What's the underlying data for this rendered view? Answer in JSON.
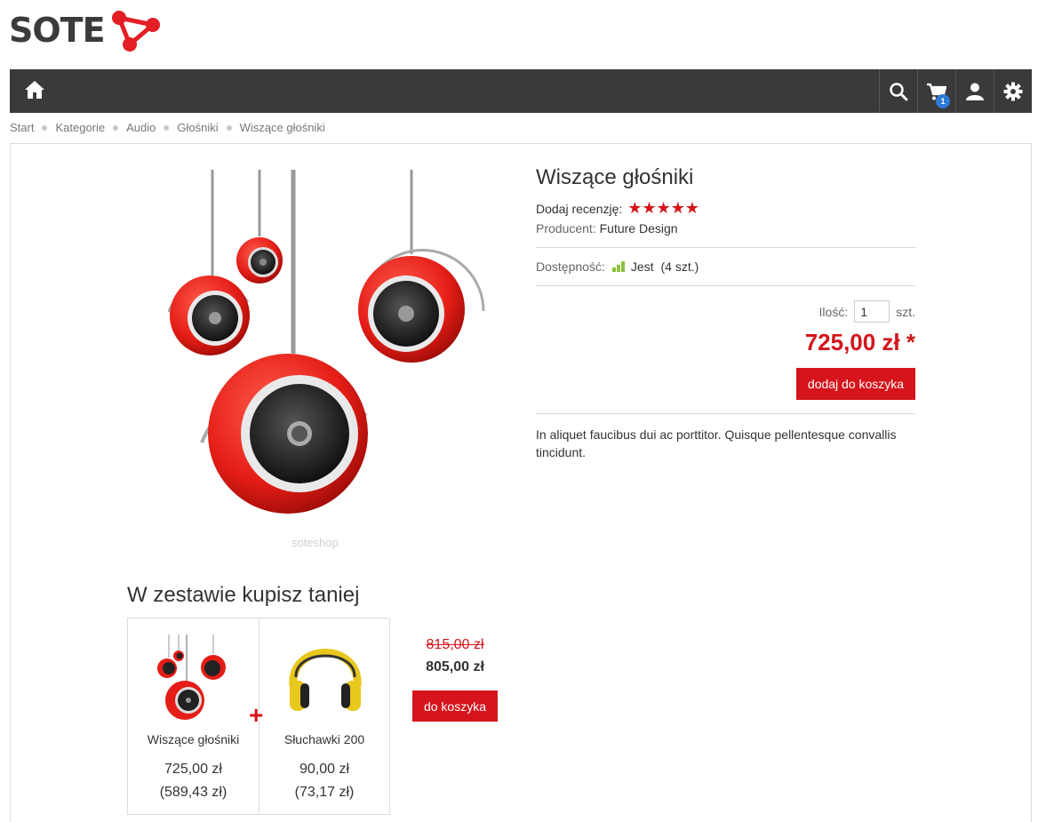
{
  "header": {
    "logo_text": "SOTE",
    "cart_count": "1",
    "nav_icons": [
      "home-icon",
      "search-icon",
      "cart-icon",
      "user-icon",
      "gear-icon"
    ]
  },
  "breadcrumb": [
    "Start",
    "Kategorie",
    "Audio",
    "Głośniki",
    "Wiszące głośniki"
  ],
  "product": {
    "watermark": "soteshop",
    "title": "Wiszące głośniki",
    "review_label": "Dodaj recenzję:",
    "stars": "★★★★★",
    "rating": 5,
    "producer_label": "Producent:",
    "producer_value": "Future Design",
    "availability_label": "Dostępność:",
    "availability_value": "Jest",
    "availability_count": "(4 szt.)",
    "qty_label": "Ilość:",
    "qty_value": "1",
    "qty_unit": "szt.",
    "price": "725,00 zł *",
    "add_to_cart": "dodaj do koszyka",
    "description": "In aliquet faucibus dui ac porttitor. Quisque pellentesque convallis tincidunt."
  },
  "set": {
    "title": "W zestawie kupisz taniej",
    "items": [
      {
        "name": "Wiszące głośniki",
        "price": "725,00 zł",
        "net": "(589,43 zł)"
      },
      {
        "name": "Słuchawki 200",
        "price": "90,00 zł",
        "net": "(73,17 zł)"
      }
    ],
    "plus": "+",
    "old_price": "815,00 zł",
    "new_price": "805,00 zł",
    "button": "do koszyka"
  },
  "colors": {
    "accent": "#d5141b",
    "nav_bg": "#3a3a3a",
    "badge": "#2e7ad9",
    "availability": "#8ac13b"
  }
}
